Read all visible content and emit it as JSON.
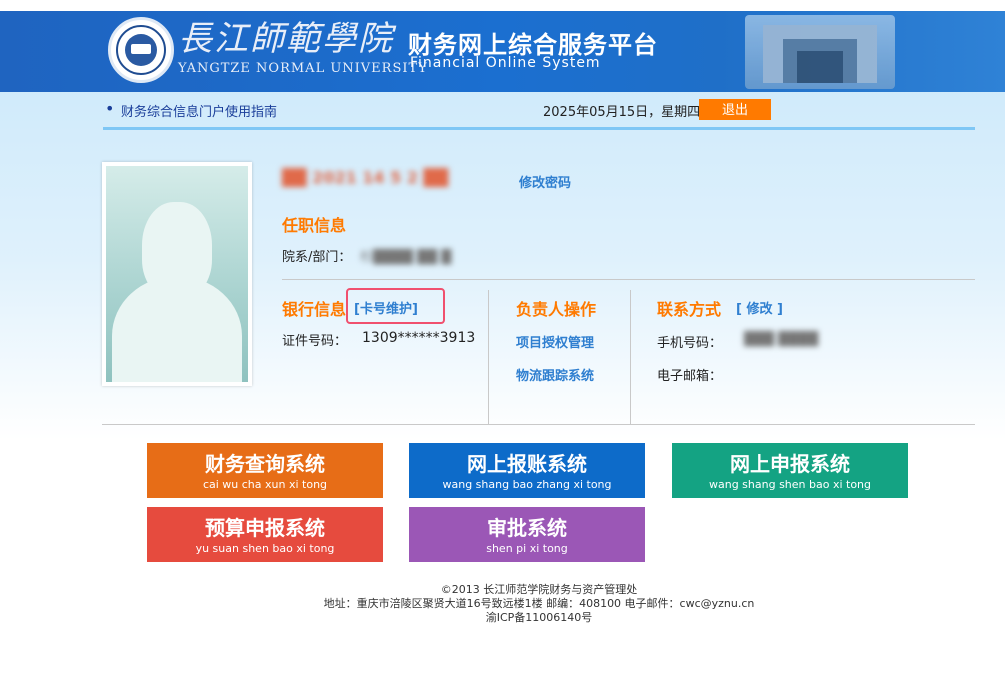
{
  "header": {
    "university_cn": "長江師範學院",
    "university_en": "YANGTZE NORMAL UNIVERSITY",
    "system_cn": "财务网上综合服务平台",
    "system_en": "Financial Online System"
  },
  "infobar": {
    "guide_link": "财务综合信息门户使用指南",
    "date": "2025年05月15日，星期四",
    "logout": "退出"
  },
  "profile": {
    "name_blurred": "██ 2021 14 5 2 ██",
    "change_password": "修改密码",
    "employment_title": "任职信息",
    "dept_label": "院系/部门：",
    "dept_value_blurred": "杉████ ██ █",
    "bank_title": "银行信息",
    "card_maintain": "[卡号维护]",
    "id_label": "证件号码：",
    "id_value": "1309******3913",
    "manager_title": "负责人操作",
    "project_auth": "项目授权管理",
    "logistics": "物流跟踪系统",
    "contact_title": "联系方式",
    "contact_edit": "[ 修改 ]",
    "phone_label": "手机号码：",
    "phone_value_blurred": "███ ████",
    "email_label": "电子邮箱："
  },
  "tiles": [
    {
      "cn": "财务查询系统",
      "py": "cai wu cha xun xi tong",
      "color": "#e76d17"
    },
    {
      "cn": "网上报账系统",
      "py": "wang shang bao zhang xi tong",
      "color": "#0d6bc9"
    },
    {
      "cn": "网上申报系统",
      "py": "wang shang shen bao xi tong",
      "color": "#14a383"
    },
    {
      "cn": "预算申报系统",
      "py": "yu suan shen bao xi tong",
      "color": "#e64b3e"
    },
    {
      "cn": "审批系统",
      "py": "shen pi xi tong",
      "color": "#9b57b6"
    }
  ],
  "footer": {
    "line1": "©2013 长江师范学院财务与资产管理处",
    "line2": "地址：重庆市涪陵区聚贤大道16号致远楼1楼 邮编：408100 电子邮件：cwc@yznu.cn",
    "line3": "渝ICP备11006140号"
  }
}
